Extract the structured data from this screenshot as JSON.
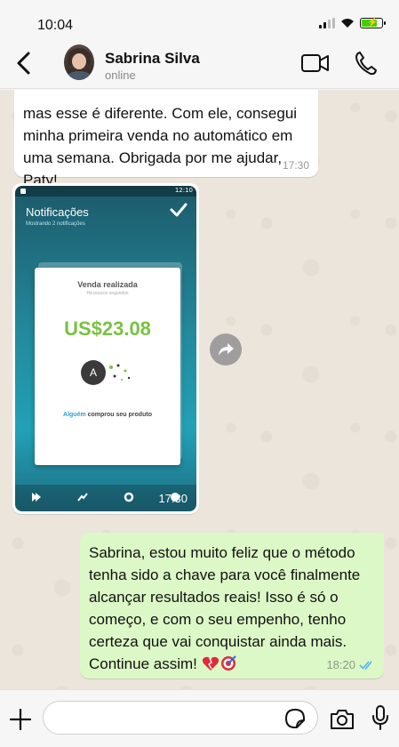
{
  "status_bar": {
    "time": "10:04"
  },
  "header": {
    "contact_name": "Sabrina Silva",
    "contact_status": "online",
    "icons": [
      "back-icon",
      "video-call-icon",
      "voice-call-icon"
    ]
  },
  "messages": [
    {
      "type": "incoming_text",
      "text": "mas esse  é diferente. Com ele, consegui minha primeira venda no automático em uma semana. Obrigada por  me ajudar, Paty!",
      "time": "17:30"
    },
    {
      "type": "incoming_image",
      "time": "17:30",
      "screenshot": {
        "title": "Notificações",
        "subtitle": "Mostrando 2 notificações",
        "status_time": "12:10",
        "card_title": "Venda realizada",
        "card_subtitle": "Há poucos segundos",
        "amount": "US$23.08",
        "avatar_letter": "A",
        "line_highlight": "Alguém",
        "line_rest": " comprou seu produto"
      }
    },
    {
      "type": "outgoing_text",
      "text": "Sabrina, estou muito feliz que o método tenha sido a chave para você finalmente alcançar resultados reais! Isso é só o começo, e com o seu empenho, tenho certeza que vai conquistar ainda mais. Continue assim! ",
      "time": "18:20",
      "emojis": [
        "heart-icon",
        "target-icon"
      ],
      "read": true
    }
  ],
  "input": {
    "placeholder": ""
  },
  "colors": {
    "chat_bg": "#ece5dc",
    "outgoing_bubble": "#dcf8c6",
    "incoming_bubble": "#ffffff",
    "read_ticks": "#4fb6ec",
    "amount_green": "#7ac143"
  }
}
